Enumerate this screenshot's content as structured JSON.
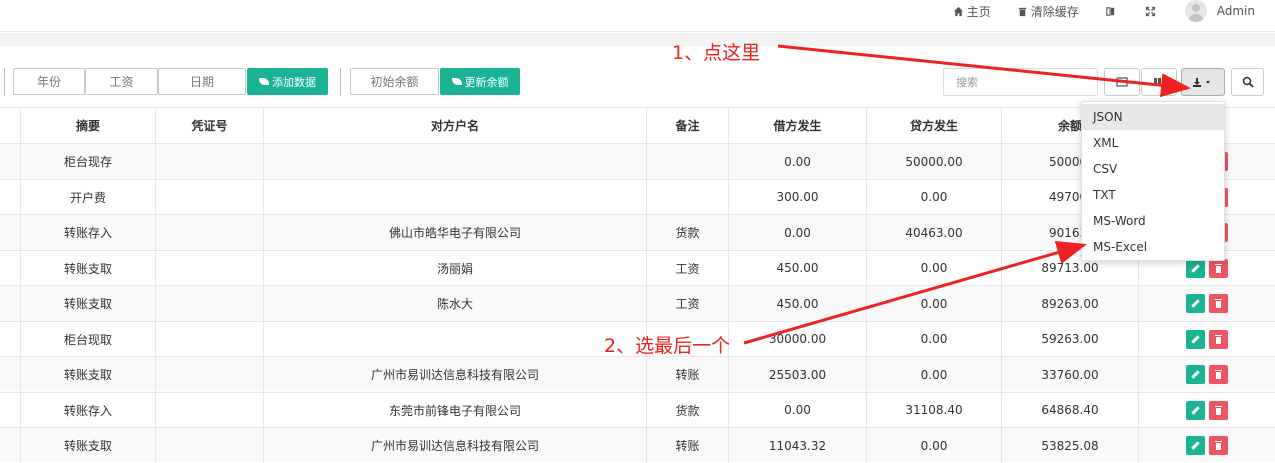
{
  "topnav": {
    "home_label": "主页",
    "clear_cache_label": "清除缓存",
    "user_name": "Admin",
    "icons": [
      "home-icon",
      "trash-icon",
      "book-icon",
      "fullscreen-icon"
    ]
  },
  "toolbar": {
    "year_label": "年份",
    "salary_label": "工资",
    "date_label": "日期",
    "add_data_label": "添加数据",
    "initial_balance_label": "初始余额",
    "update_balance_label": "更新余额",
    "search_placeholder": "搜索"
  },
  "colors": {
    "accent": "#1ab394",
    "danger": "#ed5565",
    "annotation": "#ee2222"
  },
  "table": {
    "headers": [
      "摘要",
      "凭证号",
      "对方户名",
      "备注",
      "借方发生",
      "贷方发生",
      "余额"
    ],
    "rows": [
      {
        "summary": "柜台现存",
        "voucher": "",
        "counterparty": "",
        "remark": "",
        "debit": "0.00",
        "credit": "50000.00",
        "balance": "50000."
      },
      {
        "summary": "开户费",
        "voucher": "",
        "counterparty": "",
        "remark": "",
        "debit": "300.00",
        "credit": "0.00",
        "balance": "49700."
      },
      {
        "summary": "转账存入",
        "voucher": "",
        "counterparty": "佛山市皓华电子有限公司",
        "remark": "货款",
        "debit": "0.00",
        "credit": "40463.00",
        "balance": "90163."
      },
      {
        "summary": "转账支取",
        "voucher": "",
        "counterparty": "汤丽娟",
        "remark": "工资",
        "debit": "450.00",
        "credit": "0.00",
        "balance": "89713.00"
      },
      {
        "summary": "转账支取",
        "voucher": "",
        "counterparty": "陈水大",
        "remark": "工资",
        "debit": "450.00",
        "credit": "0.00",
        "balance": "89263.00"
      },
      {
        "summary": "柜台现取",
        "voucher": "",
        "counterparty": "",
        "remark": "",
        "debit": "30000.00",
        "credit": "0.00",
        "balance": "59263.00"
      },
      {
        "summary": "转账支取",
        "voucher": "",
        "counterparty": "广州市易训达信息科技有限公司",
        "remark": "转账",
        "debit": "25503.00",
        "credit": "0.00",
        "balance": "33760.00"
      },
      {
        "summary": "转账存入",
        "voucher": "",
        "counterparty": "东莞市前锋电子有限公司",
        "remark": "货款",
        "debit": "0.00",
        "credit": "31108.40",
        "balance": "64868.40"
      },
      {
        "summary": "转账支取",
        "voucher": "",
        "counterparty": "广州市易训达信息科技有限公司",
        "remark": "转账",
        "debit": "11043.32",
        "credit": "0.00",
        "balance": "53825.08"
      }
    ]
  },
  "export_menu": {
    "items": [
      "JSON",
      "XML",
      "CSV",
      "TXT",
      "MS-Word",
      "MS-Excel"
    ],
    "highlighted": "JSON"
  },
  "annotations": {
    "step1": "1、点这里",
    "step2": "2、选最后一个"
  }
}
